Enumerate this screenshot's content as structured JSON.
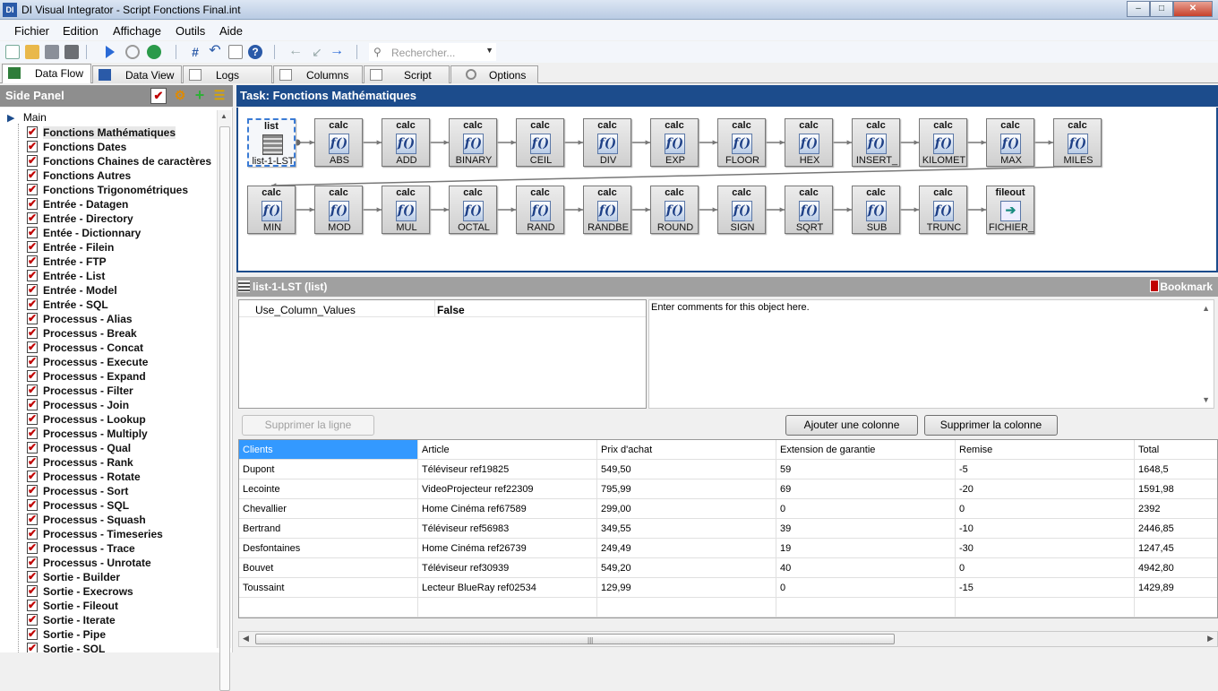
{
  "window": {
    "title": "DI Visual Integrator - Script Fonctions Final.int",
    "app_icon": "DI"
  },
  "menu": [
    {
      "label": "Fichier"
    },
    {
      "label": "Edition"
    },
    {
      "label": "Affichage"
    },
    {
      "label": "Outils"
    },
    {
      "label": "Aide"
    }
  ],
  "search": {
    "placeholder": "Rechercher..."
  },
  "tabs": [
    {
      "label": "Data Flow",
      "active": true
    },
    {
      "label": "Data View"
    },
    {
      "label": "Logs"
    },
    {
      "label": "Columns"
    },
    {
      "label": "Script"
    },
    {
      "label": "Options"
    }
  ],
  "side_panel": {
    "title": "Side Panel",
    "root": "Main",
    "items": [
      "Fonctions Mathématiques",
      "Fonctions Dates",
      "Fonctions Chaines de caractères",
      "Fonctions Autres",
      "Fonctions Trigonométriques",
      "Entrée - Datagen",
      "Entrée - Directory",
      "Entée - Dictionnary",
      "Entrée - Filein",
      "Entrée - FTP",
      "Entrée - List",
      "Entrée - Model",
      "Entrée - SQL",
      "Processus - Alias",
      "Processus - Break",
      "Processus - Concat",
      "Processus - Execute",
      "Processus - Expand",
      "Processus - Filter",
      "Processus - Join",
      "Processus - Lookup",
      "Processus - Multiply",
      "Processus - Qual",
      "Processus - Rank",
      "Processus - Rotate",
      "Processus - Sort",
      "Processus - SQL",
      "Processus - Squash",
      "Processus - Timeseries",
      "Processus - Trace",
      "Processus - Unrotate",
      "Sortie - Builder",
      "Sortie - Execrows",
      "Sortie - Fileout",
      "Sortie - Iterate",
      "Sortie - Pipe",
      "Sortie - SQL"
    ],
    "selected_index": 0
  },
  "task": {
    "title": "Task: Fonctions Mathématiques"
  },
  "flow": {
    "row1": [
      {
        "type": "list",
        "label": "list-1-LST"
      },
      {
        "type": "calc",
        "label": "ABS"
      },
      {
        "type": "calc",
        "label": "ADD"
      },
      {
        "type": "calc",
        "label": "BINARY"
      },
      {
        "type": "calc",
        "label": "CEIL"
      },
      {
        "type": "calc",
        "label": "DIV"
      },
      {
        "type": "calc",
        "label": "EXP"
      },
      {
        "type": "calc",
        "label": "FLOOR"
      },
      {
        "type": "calc",
        "label": "HEX"
      },
      {
        "type": "calc",
        "label": "INSERT_"
      },
      {
        "type": "calc",
        "label": "KILOMET"
      },
      {
        "type": "calc",
        "label": "MAX"
      },
      {
        "type": "calc",
        "label": "MILES"
      }
    ],
    "row2": [
      {
        "type": "calc",
        "label": "MIN"
      },
      {
        "type": "calc",
        "label": "MOD"
      },
      {
        "type": "calc",
        "label": "MUL"
      },
      {
        "type": "calc",
        "label": "OCTAL"
      },
      {
        "type": "calc",
        "label": "RAND"
      },
      {
        "type": "calc",
        "label": "RANDBE"
      },
      {
        "type": "calc",
        "label": "ROUND"
      },
      {
        "type": "calc",
        "label": "SIGN"
      },
      {
        "type": "calc",
        "label": "SQRT"
      },
      {
        "type": "calc",
        "label": "SUB"
      },
      {
        "type": "calc",
        "label": "TRUNC"
      },
      {
        "type": "fileout",
        "label": "FICHIER_"
      }
    ],
    "icon_text": "f()"
  },
  "object": {
    "title": "list-1-LST (list)",
    "bookmark": "Bookmark"
  },
  "props": {
    "key": "Use_Column_Values",
    "value": "False"
  },
  "comments": {
    "text": "Enter comments for this object here."
  },
  "buttons": {
    "delete_row": "Supprimer la ligne",
    "add_col": "Ajouter une colonne",
    "delete_col": "Supprimer la colonne"
  },
  "grid": {
    "columns": [
      "Clients",
      "Article",
      "Prix d'achat",
      "Extension de garantie",
      "Remise",
      "Total"
    ],
    "rows": [
      [
        "Dupont",
        "Téléviseur ref19825",
        "549,50",
        "59",
        "-5",
        "1648,5"
      ],
      [
        "Lecointe",
        "VideoProjecteur ref22309",
        "795,99",
        "69",
        "-20",
        "1591,98"
      ],
      [
        "Chevallier",
        "Home Cinéma ref67589",
        "299,00",
        "0",
        "0",
        "2392"
      ],
      [
        "Bertrand",
        "Téléviseur ref56983",
        "349,55",
        "39",
        "-10",
        "2446,85"
      ],
      [
        "Desfontaines",
        "Home Cinéma ref26739",
        "249,49",
        "19",
        "-30",
        "1247,45"
      ],
      [
        "Bouvet",
        "Téléviseur ref30939",
        "549,20",
        "40",
        "0",
        "4942,80"
      ],
      [
        "Toussaint",
        "Lecteur BlueRay ref02534",
        "129,99",
        "0",
        "-15",
        "1429,89"
      ]
    ]
  },
  "colors": {
    "task_header": "#1c4c8c",
    "grid_header_selected": "#3399ff",
    "check_red": "#c00000"
  }
}
